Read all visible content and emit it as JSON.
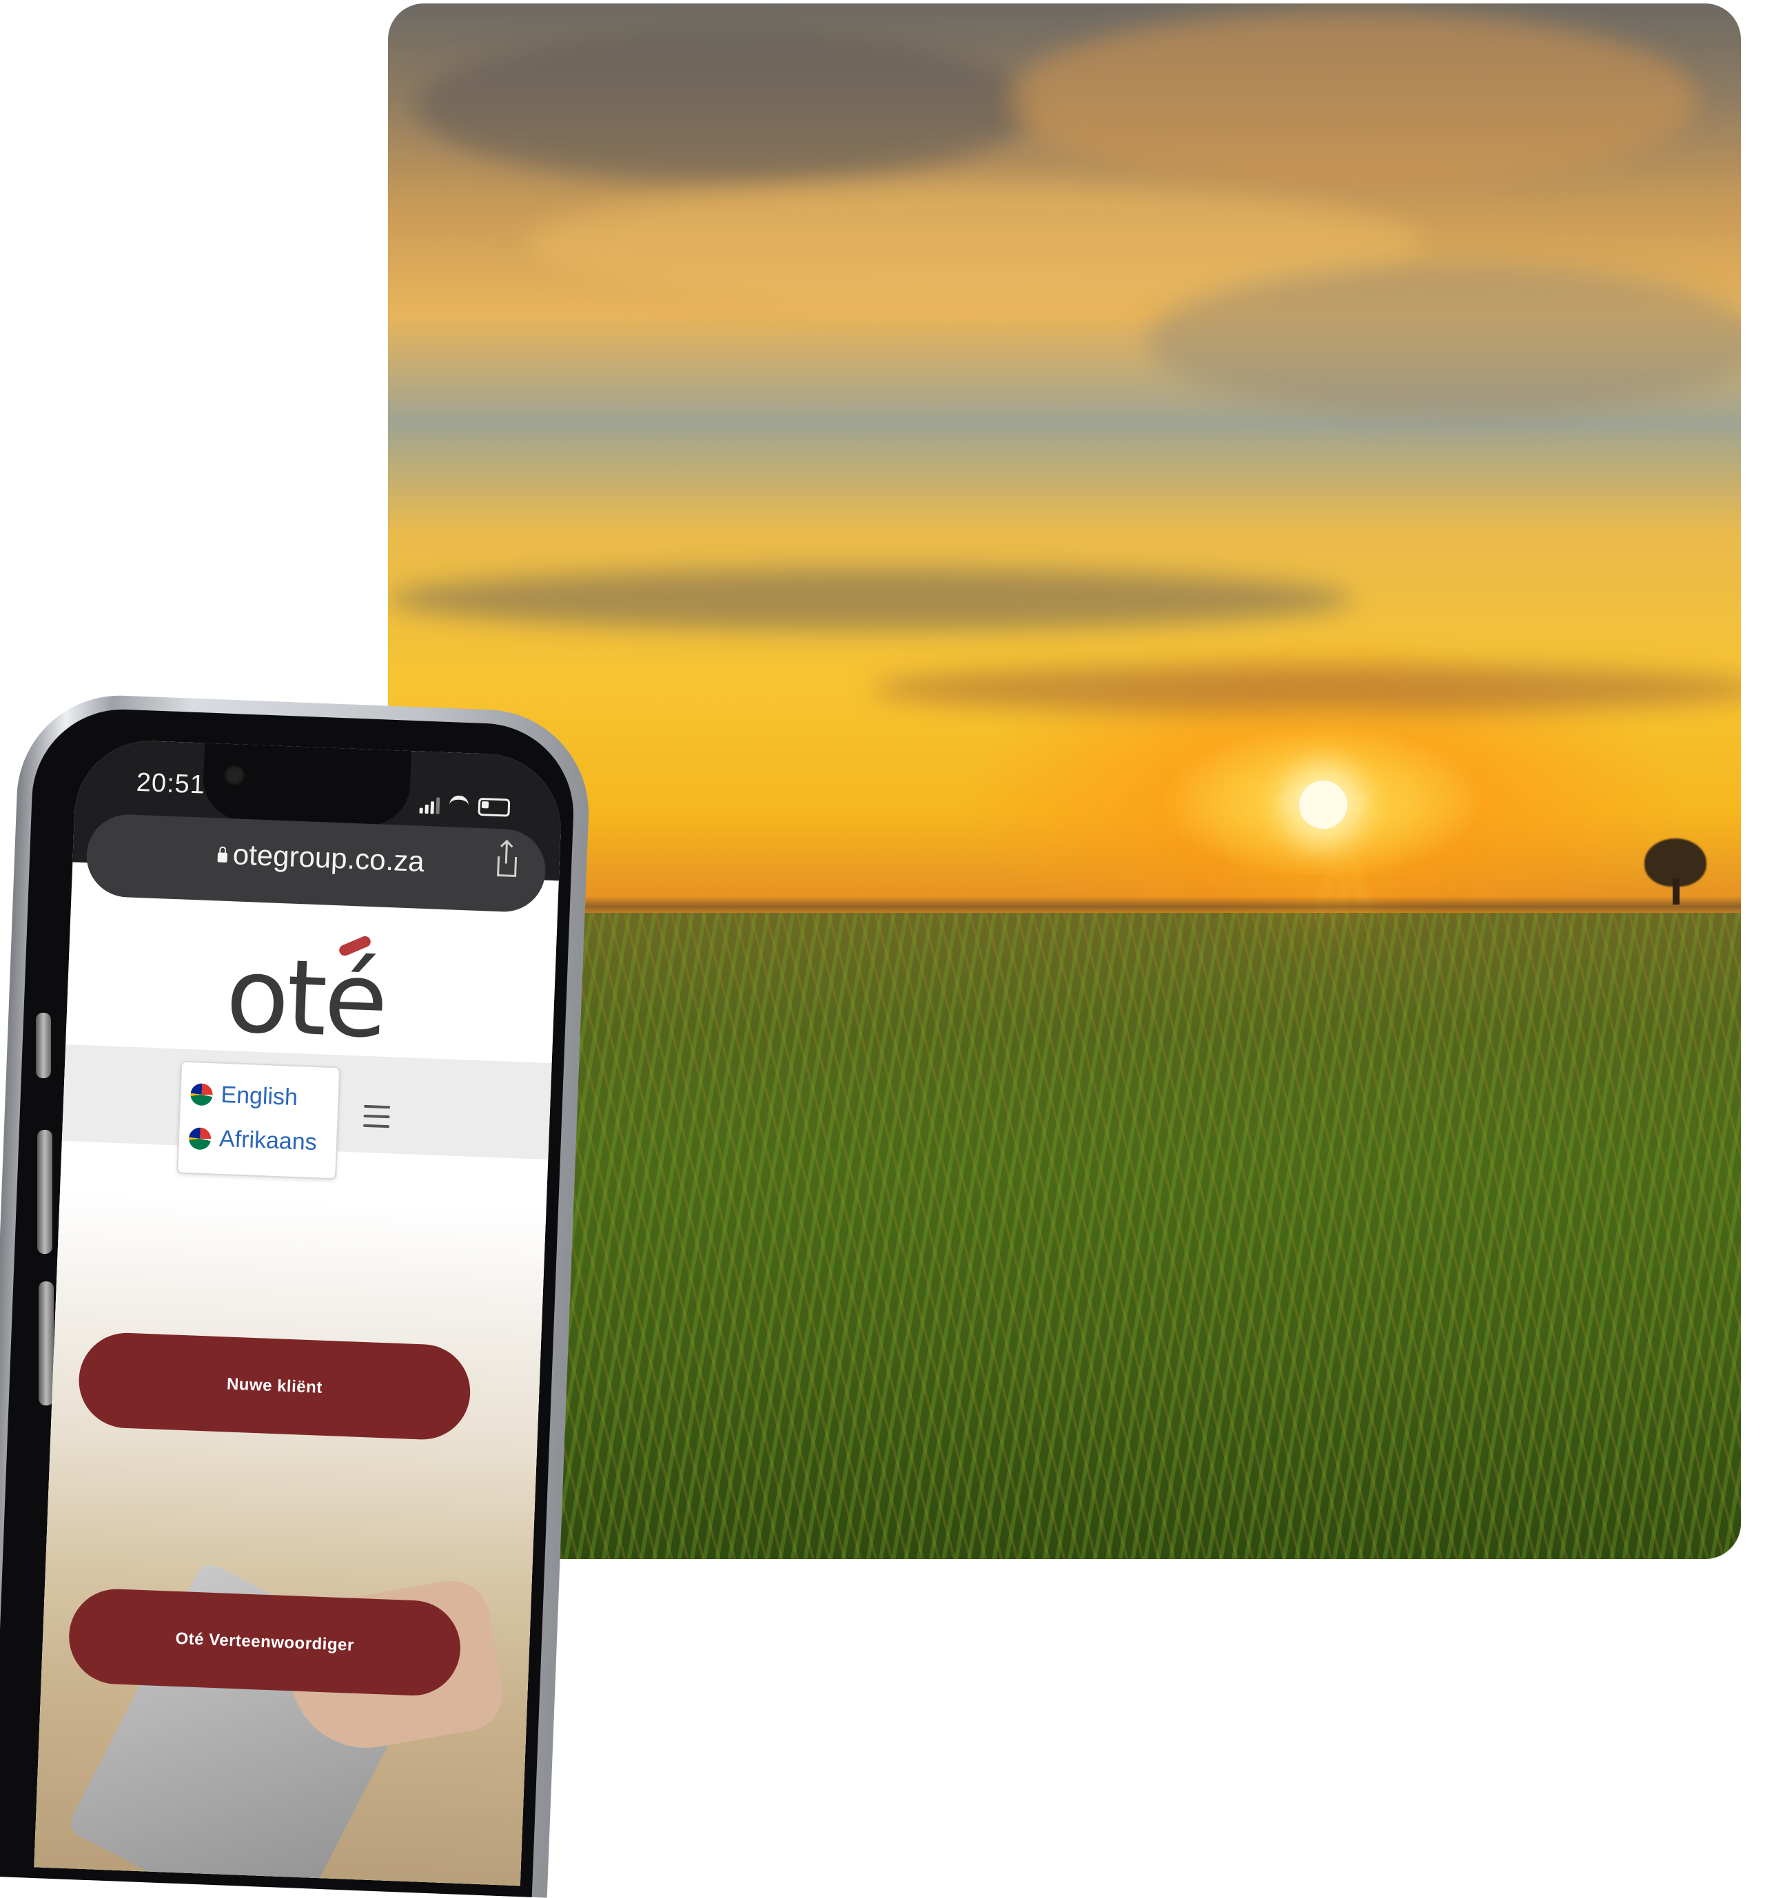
{
  "phone": {
    "status_bar": {
      "time": "20:51"
    },
    "browser": {
      "url": "otegroup.co.za"
    },
    "site": {
      "logo_text": "oté",
      "languages": [
        "English",
        "Afrikaans"
      ],
      "buttons": {
        "new_client": "Nuwe kliënt",
        "representative": "Oté Verteenwoordiger"
      }
    }
  },
  "colors": {
    "brand": "#7d2628",
    "link": "#2a66b8"
  }
}
